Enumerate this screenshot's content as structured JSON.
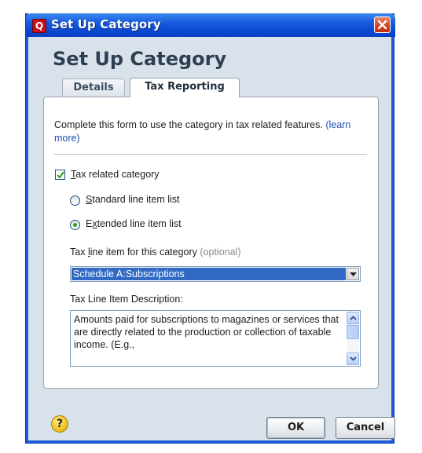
{
  "window": {
    "title": "Set Up Category",
    "app_icon_letter": "Q"
  },
  "header": {
    "title": "Set Up Category"
  },
  "tabs": [
    {
      "label": "Details",
      "active": false
    },
    {
      "label": "Tax Reporting",
      "active": true
    }
  ],
  "form": {
    "intro_text": "Complete this form to use the category in tax related features.",
    "learn_more_link": "(learn more)",
    "tax_related": {
      "checked": true,
      "label_mnemonic": "T",
      "label_rest": "ax related category"
    },
    "line_item_lists": [
      {
        "mnemonic": "S",
        "rest": "tandard line item list",
        "selected": false
      },
      {
        "prefix": "E",
        "mnemonic": "x",
        "rest": "tended line item list",
        "selected": true
      }
    ],
    "tax_line_label": {
      "part1": "Tax ",
      "mnemonic": "l",
      "part2": "ine item for this category ",
      "optional": "(optional)"
    },
    "tax_line_value": "Schedule A:Subscriptions",
    "description_label": "Tax Line Item Description:",
    "description_text": "Amounts paid for subscriptions to magazines or services that are directly related to the production or collection of taxable income.  (E.g.,"
  },
  "buttons": {
    "help_label": "?",
    "ok_label": "OK",
    "cancel_label": "Cancel"
  },
  "colors": {
    "title_bar": "#0b4bd2",
    "selection": "#316ac5",
    "link": "#1f4fb0",
    "radio_dot": "#21a121"
  }
}
